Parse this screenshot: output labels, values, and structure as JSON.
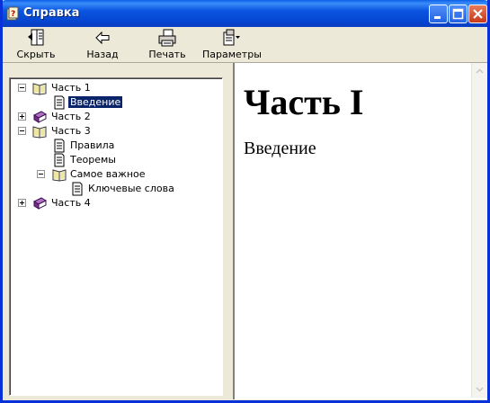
{
  "window": {
    "title": "Справка"
  },
  "toolbar": {
    "hide_label": "Скрыть",
    "back_label": "Назад",
    "print_label": "Печать",
    "options_label": "Параметры"
  },
  "tree": {
    "part1": "Часть 1",
    "intro": "Введение",
    "part2": "Часть 2",
    "part3": "Часть 3",
    "rules": "Правила",
    "theorems": "Теоремы",
    "important": "Самое важное",
    "keywords": "Ключевые слова",
    "part4": "Часть 4"
  },
  "content": {
    "heading": "Часть I",
    "text": "Введение"
  },
  "colors": {
    "titlebar": "#0a55e0",
    "selection": "#0a246a",
    "book": "#7a2a8a"
  }
}
